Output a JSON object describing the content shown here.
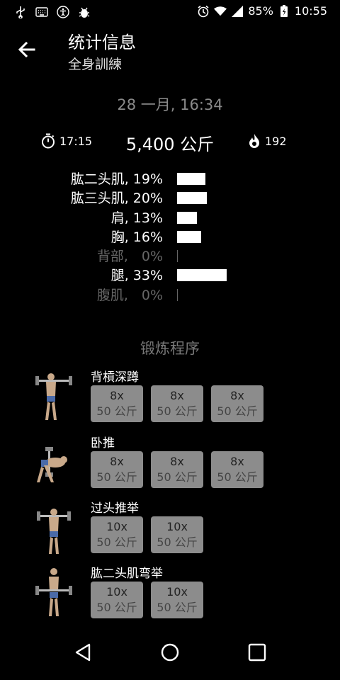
{
  "status": {
    "battery": "85%",
    "time": "10:55"
  },
  "header": {
    "title": "统计信息",
    "subtitle": "全身訓練"
  },
  "workout": {
    "date": "28 一月, 16:34",
    "duration": "17:15",
    "total_weight": "5,400 公斤",
    "calories": "192"
  },
  "muscles": [
    {
      "label": "肱二头肌, 19%",
      "percent": 19
    },
    {
      "label": "肱三头肌, 20%",
      "percent": 20
    },
    {
      "label": "肩, 13%",
      "percent": 13
    },
    {
      "label": "胸, 16%",
      "percent": 16
    },
    {
      "label": "背部,　0%",
      "percent": 0
    },
    {
      "label": "腿, 33%",
      "percent": 33
    },
    {
      "label": "腹肌,　0%",
      "percent": 0
    }
  ],
  "program": {
    "title": "锻炼程序",
    "exercises": [
      {
        "name": "背槓深蹲",
        "sets": [
          {
            "reps": "8x",
            "weight": "50 公斤"
          },
          {
            "reps": "8x",
            "weight": "50 公斤"
          },
          {
            "reps": "8x",
            "weight": "50 公斤"
          }
        ]
      },
      {
        "name": "卧推",
        "sets": [
          {
            "reps": "8x",
            "weight": "50 公斤"
          },
          {
            "reps": "8x",
            "weight": "50 公斤"
          },
          {
            "reps": "8x",
            "weight": "50 公斤"
          }
        ]
      },
      {
        "name": "过头推举",
        "sets": [
          {
            "reps": "10x",
            "weight": "50 公斤"
          },
          {
            "reps": "10x",
            "weight": "50 公斤"
          }
        ]
      },
      {
        "name": "肱二头肌弯举",
        "sets": [
          {
            "reps": "10x",
            "weight": "50 公斤"
          },
          {
            "reps": "10x",
            "weight": "50 公斤"
          }
        ]
      }
    ]
  },
  "icons": [
    "usb-icon",
    "keyboard-icon",
    "accessibility-icon",
    "debug-icon",
    "alarm-icon",
    "wifi-icon",
    "signal-icon",
    "battery-icon",
    "back-arrow-icon",
    "stopwatch-icon",
    "flame-icon",
    "nav-back-icon",
    "nav-home-icon",
    "nav-recents-icon"
  ]
}
